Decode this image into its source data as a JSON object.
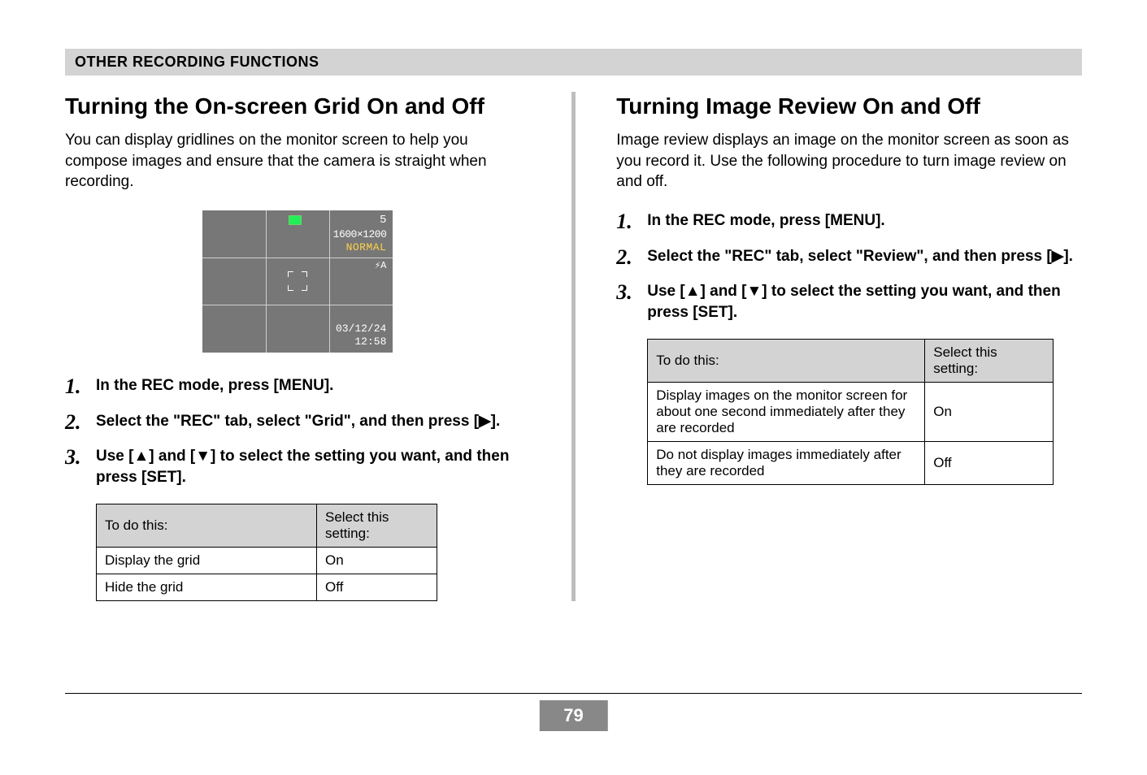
{
  "section_bar": "OTHER RECORDING FUNCTIONS",
  "page_number": "79",
  "left": {
    "heading": "Turning the On-screen Grid On and Off",
    "para": "You can display gridlines on the monitor screen to help you compose images and ensure that the camera is straight when recording.",
    "lcd": {
      "count": "5",
      "resolution": "1600×1200",
      "quality": "NORMAL",
      "flash": "⚡A",
      "date": "03/12/24",
      "time": "12:58"
    },
    "steps": [
      "In the REC mode, press [MENU].",
      "Select the \"REC\" tab, select \"Grid\", and then press [▶].",
      "Use [▲] and [▼] to select the setting you want, and then press [SET]."
    ],
    "table": {
      "header": [
        "To do this:",
        "Select this setting:"
      ],
      "rows": [
        [
          "Display the grid",
          "On"
        ],
        [
          "Hide the grid",
          "Off"
        ]
      ]
    }
  },
  "right": {
    "heading": "Turning Image Review On and Off",
    "para": "Image review displays an image on the monitor screen as soon as you record it. Use the following procedure to turn image review on and off.",
    "steps": [
      "In the REC mode, press [MENU].",
      "Select the \"REC\" tab, select \"Review\", and then press [▶].",
      "Use [▲] and [▼] to select the setting you want, and then press [SET]."
    ],
    "table": {
      "header": [
        "To do this:",
        "Select this setting:"
      ],
      "rows": [
        [
          "Display images on the monitor screen for about one second immediately after they are recorded",
          "On"
        ],
        [
          "Do not display images immediately after they are recorded",
          "Off"
        ]
      ]
    }
  }
}
